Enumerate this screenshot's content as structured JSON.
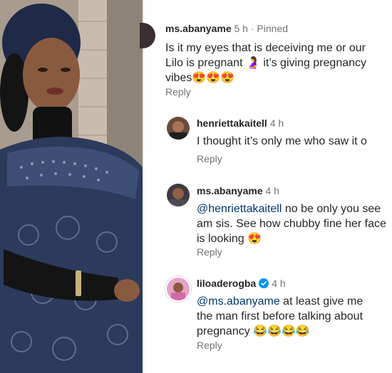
{
  "comments": [
    {
      "username": "ms.abanyame",
      "time": "5 h",
      "separator": " · ",
      "pinned": "Pinned",
      "text": "Is it my eyes that is deceiving me or our Lilo is pregnant 🤰 it’s giving pregnancy vibes😍😍😍",
      "reply": "Reply"
    },
    {
      "username": "henriettakaitell",
      "time": "4 h",
      "text": "I thought it’s only me who saw it o",
      "reply": "Reply"
    },
    {
      "username": "ms.abanyame",
      "time": "4 h",
      "mention": "@henriettakaitell",
      "text": " no be only you see am sis. See how chubby fine her face is looking 😍",
      "reply": "Reply"
    },
    {
      "username": "liloaderogba",
      "verified": true,
      "time": "4 h",
      "mention": "@ms.abanyame",
      "text": " at least give me the man first before talking about pregnancy 😂😂😂😂",
      "reply": "Reply"
    }
  ],
  "colors": {
    "username": "#262626",
    "meta": "#737373",
    "mention": "#00376b",
    "verified": "#0095f6"
  }
}
